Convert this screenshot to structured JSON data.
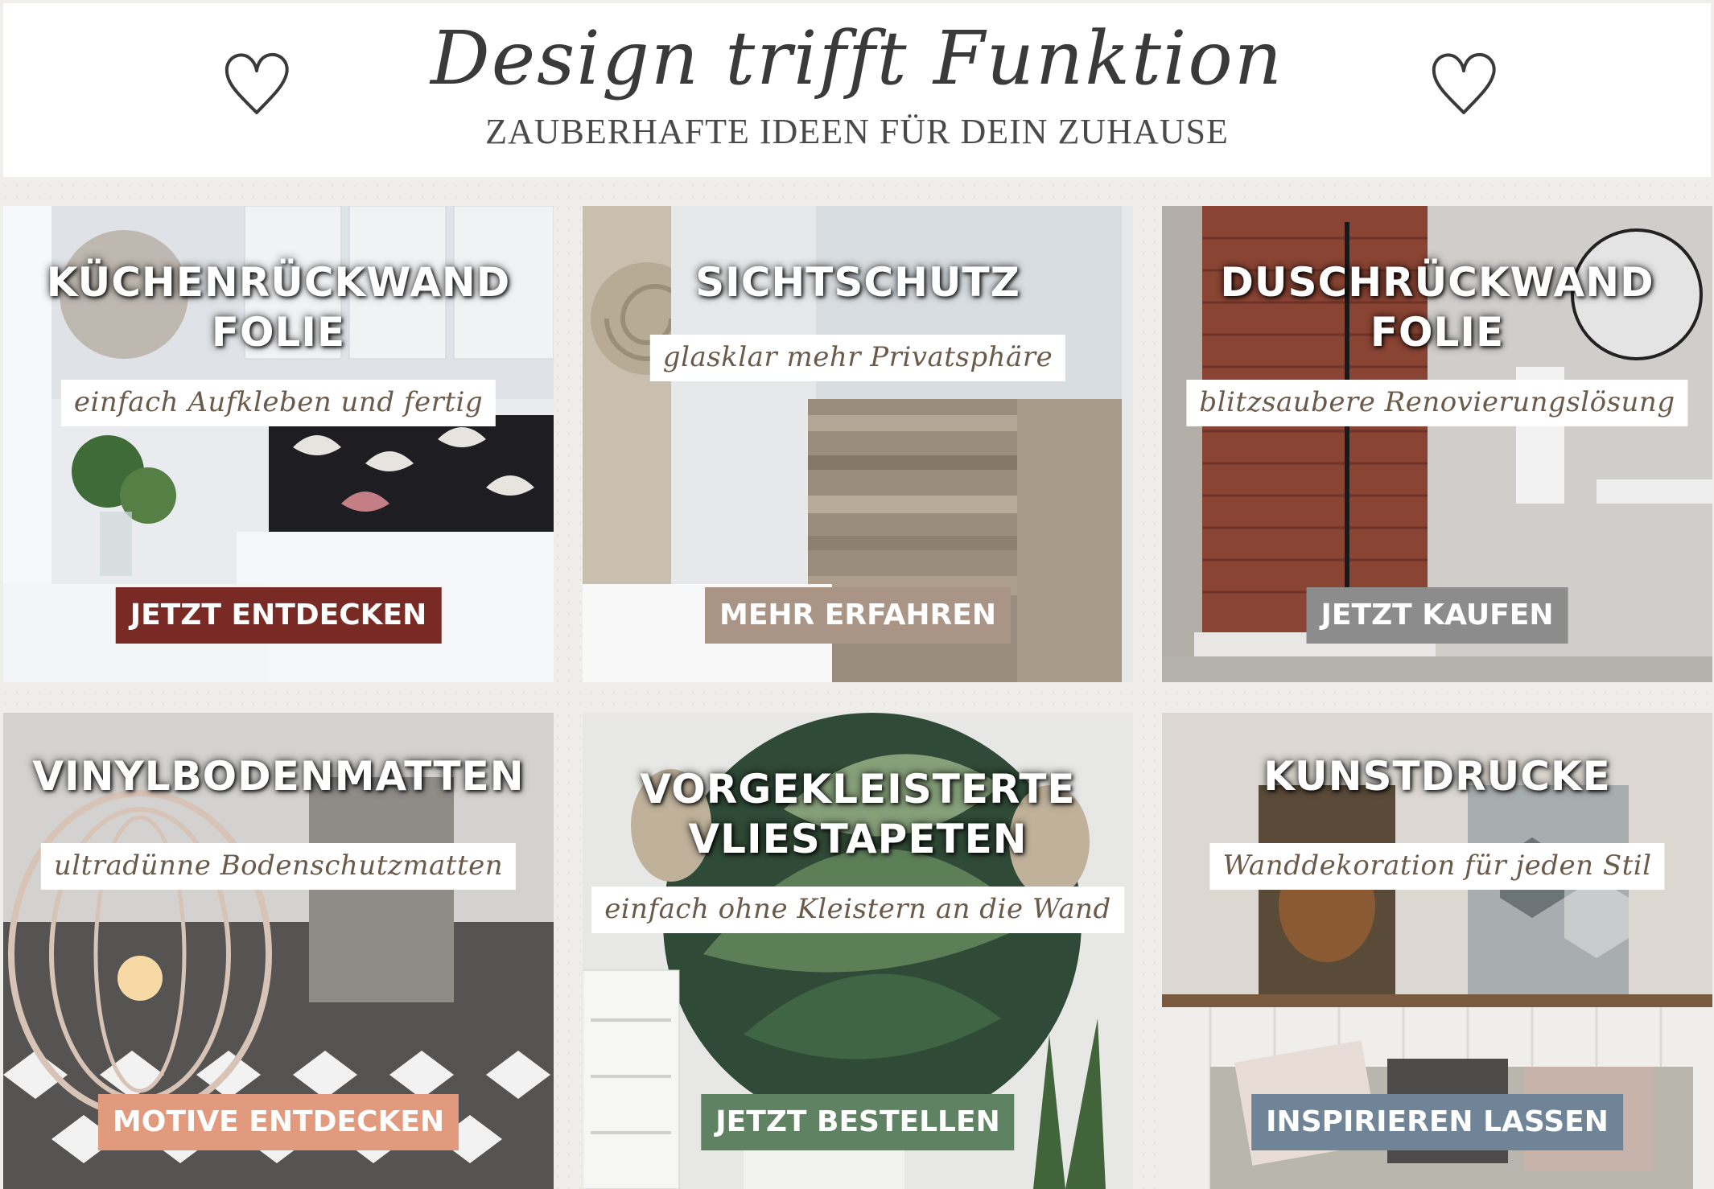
{
  "header": {
    "headline": "Design trifft Funktion",
    "subline": "ZAUBERHAFTE IDEEN FÜR DEIN ZUHAUSE",
    "icons": [
      "heart-outline-icon",
      "heart-outline-icon"
    ]
  },
  "tiles": [
    {
      "title": "KÜCHENRÜCKWAND\nFOLIE",
      "tagline": "einfach Aufkleben und fertig",
      "button": "JETZT ENTDECKEN",
      "button_color": "#7a2a25"
    },
    {
      "title": "SICHTSCHUTZ",
      "tagline": "glasklar mehr Privatsphäre",
      "button": "MEHR ERFAHREN",
      "button_color": "#a99485"
    },
    {
      "title": "DUSCHRÜCKWAND\nFOLIE",
      "tagline": "blitzsaubere Renovierungslösung",
      "button": "JETZT KAUFEN",
      "button_color": "#8c8c8c"
    },
    {
      "title": "VINYLBODENMATTEN",
      "tagline": "ultradünne Bodenschutzmatten",
      "button": "MOTIVE ENTDECKEN",
      "button_color": "#e19a7d"
    },
    {
      "title": "VORGEKLEISTERTE\nVLIESTAPETEN",
      "tagline": "einfach ohne Kleistern an die Wand",
      "button": "JETZT BESTELLEN",
      "button_color": "#5f8262"
    },
    {
      "title": "KUNSTDRUCKE",
      "tagline": "Wanddekoration für jeden Stil",
      "button": "INSPIRIEREN LASSEN",
      "button_color": "#6f8497"
    }
  ]
}
